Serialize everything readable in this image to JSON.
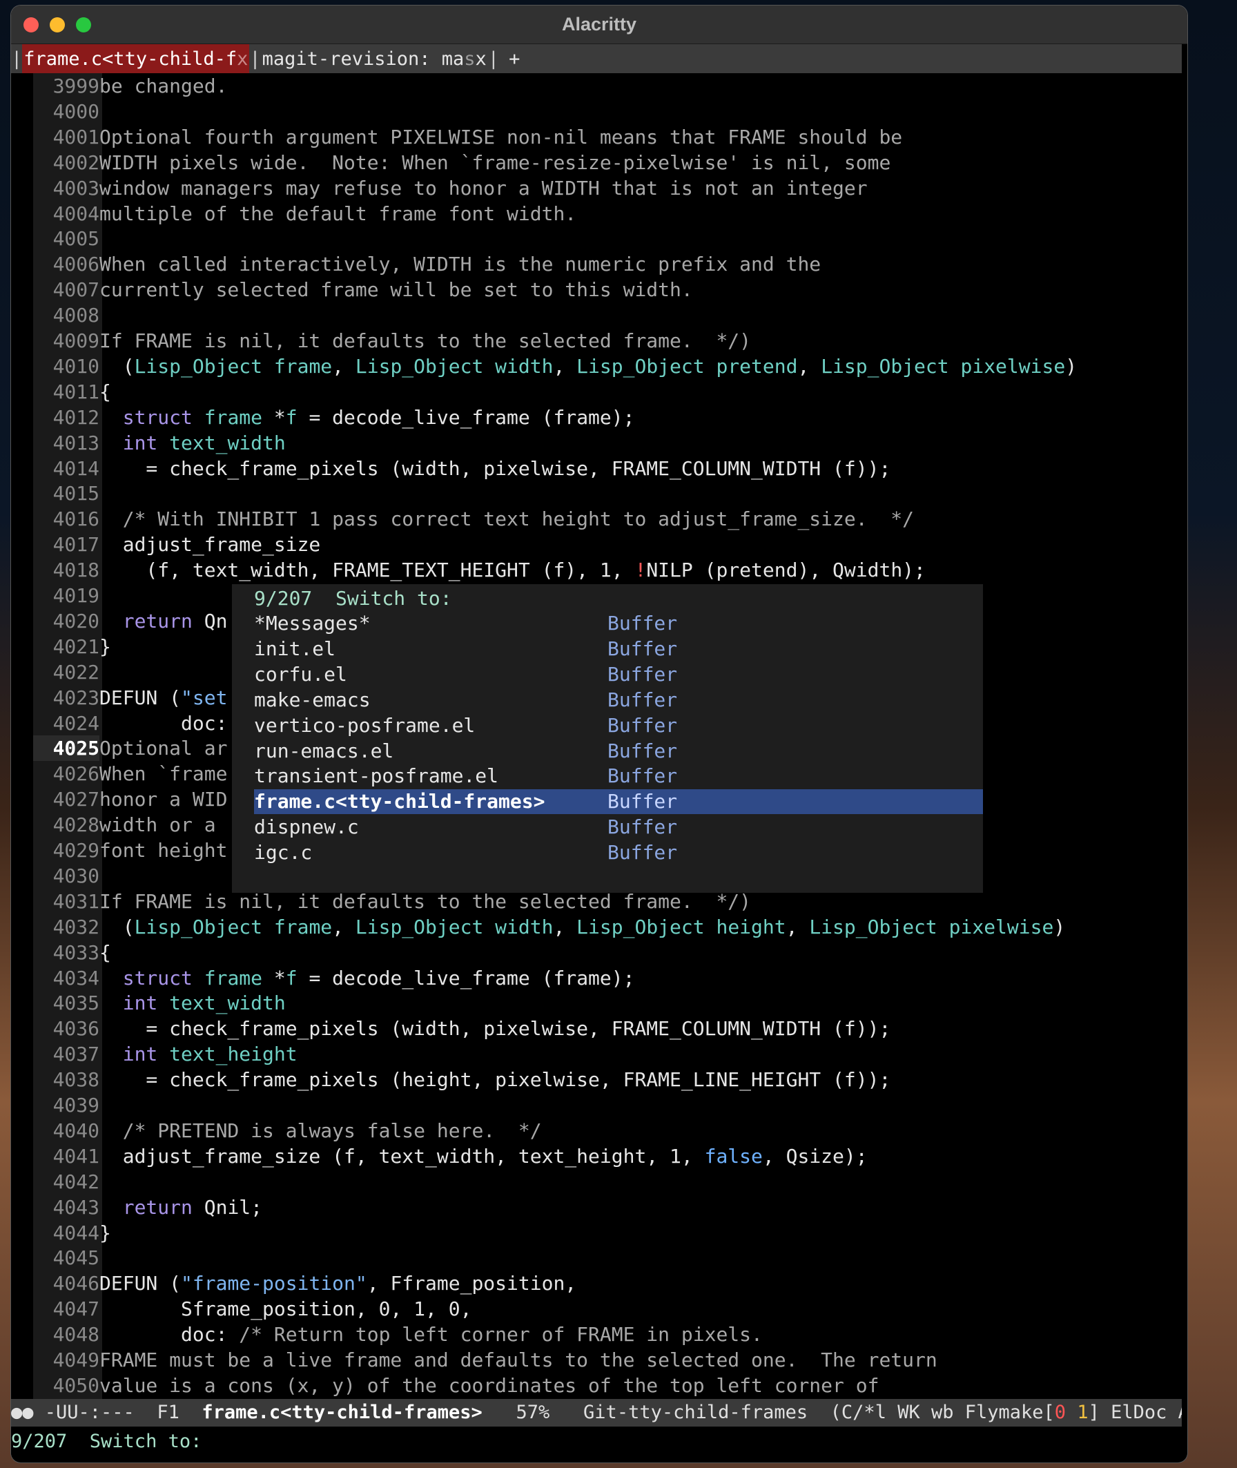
{
  "window": {
    "title": "Alacritty"
  },
  "tabs": {
    "active": {
      "label": "frame.c<tty-child-f",
      "fade": "x"
    },
    "inactive": {
      "label": "magit-revision: ma",
      "fade": "s",
      "tail": "x"
    },
    "new_tab": "+"
  },
  "editor": {
    "current_line": 4025,
    "lines": [
      {
        "n": "3999",
        "parts": [
          [
            "cm",
            "be changed."
          ]
        ]
      },
      {
        "n": "4000",
        "parts": []
      },
      {
        "n": "4001",
        "parts": [
          [
            "cm",
            "Optional fourth argument PIXELWISE non-nil means that FRAME should be"
          ]
        ]
      },
      {
        "n": "4002",
        "parts": [
          [
            "cm",
            "WIDTH pixels wide.  Note: When `frame-resize-pixelwise' is nil, some"
          ]
        ]
      },
      {
        "n": "4003",
        "parts": [
          [
            "cm",
            "window managers may refuse to honor a WIDTH that is not an integer"
          ]
        ]
      },
      {
        "n": "4004",
        "parts": [
          [
            "cm",
            "multiple of the default frame font width."
          ]
        ]
      },
      {
        "n": "4005",
        "parts": []
      },
      {
        "n": "4006",
        "parts": [
          [
            "cm",
            "When called interactively, WIDTH is the numeric prefix and the"
          ]
        ]
      },
      {
        "n": "4007",
        "parts": [
          [
            "cm",
            "currently selected frame will be set to this width."
          ]
        ]
      },
      {
        "n": "4008",
        "parts": []
      },
      {
        "n": "4009",
        "parts": [
          [
            "cm",
            "If FRAME is nil, it defaults to the selected frame.  */)"
          ]
        ]
      },
      {
        "n": "4010",
        "parts": [
          [
            "",
            "  ("
          ],
          [
            "ty",
            "Lisp_Object frame"
          ],
          [
            "",
            ", "
          ],
          [
            "ty",
            "Lisp_Object width"
          ],
          [
            "",
            ", "
          ],
          [
            "ty",
            "Lisp_Object pretend"
          ],
          [
            "",
            ", "
          ],
          [
            "ty",
            "Lisp_Object pixelwise"
          ],
          [
            "",
            ")"
          ]
        ]
      },
      {
        "n": "4011",
        "parts": [
          [
            "",
            "{"
          ]
        ]
      },
      {
        "n": "4012",
        "parts": [
          [
            "",
            "  "
          ],
          [
            "kw",
            "struct"
          ],
          [
            "ty",
            " frame"
          ],
          [
            "",
            " *"
          ],
          [
            "ty",
            "f"
          ],
          [
            "",
            " = decode_live_frame (frame);"
          ]
        ]
      },
      {
        "n": "4013",
        "parts": [
          [
            "",
            "  "
          ],
          [
            "kw",
            "int"
          ],
          [
            "ty",
            " text_width"
          ]
        ]
      },
      {
        "n": "4014",
        "parts": [
          [
            "",
            "    = check_frame_pixels (width, pixelwise, FRAME_COLUMN_WIDTH (f));"
          ]
        ]
      },
      {
        "n": "4015",
        "parts": []
      },
      {
        "n": "4016",
        "parts": [
          [
            "",
            "  "
          ],
          [
            "cm",
            "/* With INHIBIT 1 pass correct text height to adjust_frame_size.  */"
          ]
        ]
      },
      {
        "n": "4017",
        "parts": [
          [
            "",
            "  adjust_frame_size"
          ]
        ]
      },
      {
        "n": "4018",
        "parts": [
          [
            "",
            "    (f, text_width, FRAME_TEXT_HEIGHT (f), 1, "
          ],
          [
            "err",
            "!"
          ],
          [
            "",
            "NILP (pretend), Qwidth);"
          ]
        ]
      },
      {
        "n": "4019",
        "parts": []
      },
      {
        "n": "4020",
        "parts": [
          [
            "",
            "  "
          ],
          [
            "kw",
            "return"
          ],
          [
            "",
            " Qn"
          ]
        ]
      },
      {
        "n": "4021",
        "parts": [
          [
            "",
            "}"
          ]
        ]
      },
      {
        "n": "4022",
        "parts": []
      },
      {
        "n": "4023",
        "parts": [
          [
            "",
            "DEFUN ("
          ],
          [
            "str",
            "\"set"
          ]
        ]
      },
      {
        "n": "4024",
        "parts": [
          [
            "",
            "       doc:                                                             s."
          ]
        ]
      },
      {
        "n": "4025",
        "parts": [
          [
            "cm",
            "Optional ar"
          ]
        ]
      },
      {
        "n": "4026",
        "parts": [
          [
            "cm",
            "When `frame"
          ]
        ]
      },
      {
        "n": "4027",
        "parts": [
          [
            "cm",
            "honor a WID"
          ]
        ]
      },
      {
        "n": "4028",
        "parts": [
          [
            "cm",
            "width or a "
          ]
        ]
      },
      {
        "n": "4029",
        "parts": [
          [
            "cm",
            "font height"
          ]
        ]
      },
      {
        "n": "4030",
        "parts": []
      },
      {
        "n": "4031",
        "parts": [
          [
            "cm",
            "If FRAME is nil, it defaults to the selected frame.  */)"
          ]
        ]
      },
      {
        "n": "4032",
        "parts": [
          [
            "",
            "  ("
          ],
          [
            "ty",
            "Lisp_Object frame"
          ],
          [
            "",
            ", "
          ],
          [
            "ty",
            "Lisp_Object width"
          ],
          [
            "",
            ", "
          ],
          [
            "ty",
            "Lisp_Object height"
          ],
          [
            "",
            ", "
          ],
          [
            "ty",
            "Lisp_Object pixelwise"
          ],
          [
            "",
            ")"
          ]
        ]
      },
      {
        "n": "4033",
        "parts": [
          [
            "",
            "{"
          ]
        ]
      },
      {
        "n": "4034",
        "parts": [
          [
            "",
            "  "
          ],
          [
            "kw",
            "struct"
          ],
          [
            "ty",
            " frame"
          ],
          [
            "",
            " *"
          ],
          [
            "ty",
            "f"
          ],
          [
            "",
            " = decode_live_frame (frame);"
          ]
        ]
      },
      {
        "n": "4035",
        "parts": [
          [
            "",
            "  "
          ],
          [
            "kw",
            "int"
          ],
          [
            "ty",
            " text_width"
          ]
        ]
      },
      {
        "n": "4036",
        "parts": [
          [
            "",
            "    = check_frame_pixels (width, pixelwise, FRAME_COLUMN_WIDTH (f));"
          ]
        ]
      },
      {
        "n": "4037",
        "parts": [
          [
            "",
            "  "
          ],
          [
            "kw",
            "int"
          ],
          [
            "ty",
            " text_height"
          ]
        ]
      },
      {
        "n": "4038",
        "parts": [
          [
            "",
            "    = check_frame_pixels (height, pixelwise, FRAME_LINE_HEIGHT (f));"
          ]
        ]
      },
      {
        "n": "4039",
        "parts": []
      },
      {
        "n": "4040",
        "parts": [
          [
            "",
            "  "
          ],
          [
            "cm",
            "/* PRETEND is always false here.  */"
          ]
        ]
      },
      {
        "n": "4041",
        "parts": [
          [
            "",
            "  adjust_frame_size (f, text_width, text_height, 1, "
          ],
          [
            "bool",
            "false"
          ],
          [
            "",
            ", Qsize);"
          ]
        ]
      },
      {
        "n": "4042",
        "parts": []
      },
      {
        "n": "4043",
        "parts": [
          [
            "",
            "  "
          ],
          [
            "kw",
            "return"
          ],
          [
            "",
            " Qnil;"
          ]
        ]
      },
      {
        "n": "4044",
        "parts": [
          [
            "",
            "}"
          ]
        ]
      },
      {
        "n": "4045",
        "parts": []
      },
      {
        "n": "4046",
        "parts": [
          [
            "",
            "DEFUN ("
          ],
          [
            "str",
            "\"frame-position\""
          ],
          [
            "",
            ", Fframe_position,"
          ]
        ]
      },
      {
        "n": "4047",
        "parts": [
          [
            "",
            "       Sframe_position, 0, 1, 0,"
          ]
        ]
      },
      {
        "n": "4048",
        "parts": [
          [
            "",
            "       doc: "
          ],
          [
            "cm",
            "/* Return top left corner of FRAME in pixels."
          ]
        ]
      },
      {
        "n": "4049",
        "parts": [
          [
            "cm",
            "FRAME must be a live frame and defaults to the selected one.  The return"
          ]
        ]
      },
      {
        "n": "4050",
        "parts": [
          [
            "cm",
            "value is a cons (x, y) of the coordinates of the top left corner of"
          ]
        ]
      }
    ]
  },
  "switcher": {
    "header": "9/207  Switch to:",
    "items": [
      {
        "name": "*Messages*",
        "kind": "Buffer"
      },
      {
        "name": "init.el",
        "kind": "Buffer"
      },
      {
        "name": "corfu.el",
        "kind": "Buffer"
      },
      {
        "name": "make-emacs",
        "kind": "Buffer"
      },
      {
        "name": "vertico-posframe.el",
        "kind": "Buffer"
      },
      {
        "name": "run-emacs.el",
        "kind": "Buffer"
      },
      {
        "name": "transient-posframe.el",
        "kind": "Buffer"
      },
      {
        "name": "frame.c<tty-child-frames>",
        "kind": "Buffer",
        "selected": true
      },
      {
        "name": "dispnew.c",
        "kind": "Buffer"
      },
      {
        "name": "igc.c",
        "kind": "Buffer"
      }
    ]
  },
  "modeline": {
    "prefix": "●● -UU-:---  F1  ",
    "buffer": "frame.c<tty-child-frames>",
    "position": "   57%   ",
    "branch": "Git-tty-child-frames",
    "modes": "  (C/*l WK wb Flymake[",
    "flymake_err": "0",
    "flymake_warn": "1",
    "modes_tail": "] ElDoc Ab"
  },
  "minibuffer": {
    "prompt": "9/207  Switch to:"
  }
}
